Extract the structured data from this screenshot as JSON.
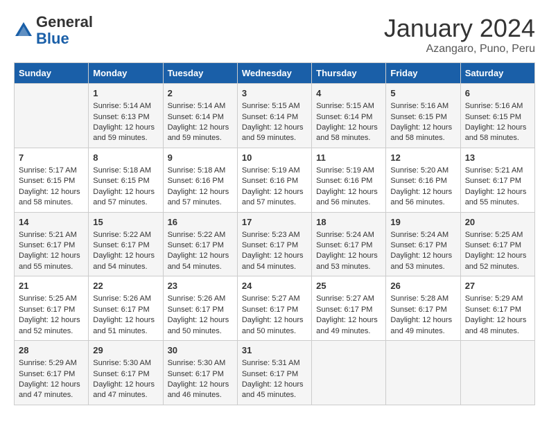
{
  "header": {
    "logo_general": "General",
    "logo_blue": "Blue",
    "month": "January 2024",
    "location": "Azangaro, Puno, Peru"
  },
  "days_of_week": [
    "Sunday",
    "Monday",
    "Tuesday",
    "Wednesday",
    "Thursday",
    "Friday",
    "Saturday"
  ],
  "weeks": [
    [
      {
        "day": "",
        "info": ""
      },
      {
        "day": "1",
        "info": "Sunrise: 5:14 AM\nSunset: 6:13 PM\nDaylight: 12 hours\nand 59 minutes."
      },
      {
        "day": "2",
        "info": "Sunrise: 5:14 AM\nSunset: 6:14 PM\nDaylight: 12 hours\nand 59 minutes."
      },
      {
        "day": "3",
        "info": "Sunrise: 5:15 AM\nSunset: 6:14 PM\nDaylight: 12 hours\nand 59 minutes."
      },
      {
        "day": "4",
        "info": "Sunrise: 5:15 AM\nSunset: 6:14 PM\nDaylight: 12 hours\nand 58 minutes."
      },
      {
        "day": "5",
        "info": "Sunrise: 5:16 AM\nSunset: 6:15 PM\nDaylight: 12 hours\nand 58 minutes."
      },
      {
        "day": "6",
        "info": "Sunrise: 5:16 AM\nSunset: 6:15 PM\nDaylight: 12 hours\nand 58 minutes."
      }
    ],
    [
      {
        "day": "7",
        "info": "Sunrise: 5:17 AM\nSunset: 6:15 PM\nDaylight: 12 hours\nand 58 minutes."
      },
      {
        "day": "8",
        "info": "Sunrise: 5:18 AM\nSunset: 6:15 PM\nDaylight: 12 hours\nand 57 minutes."
      },
      {
        "day": "9",
        "info": "Sunrise: 5:18 AM\nSunset: 6:16 PM\nDaylight: 12 hours\nand 57 minutes."
      },
      {
        "day": "10",
        "info": "Sunrise: 5:19 AM\nSunset: 6:16 PM\nDaylight: 12 hours\nand 57 minutes."
      },
      {
        "day": "11",
        "info": "Sunrise: 5:19 AM\nSunset: 6:16 PM\nDaylight: 12 hours\nand 56 minutes."
      },
      {
        "day": "12",
        "info": "Sunrise: 5:20 AM\nSunset: 6:16 PM\nDaylight: 12 hours\nand 56 minutes."
      },
      {
        "day": "13",
        "info": "Sunrise: 5:21 AM\nSunset: 6:17 PM\nDaylight: 12 hours\nand 55 minutes."
      }
    ],
    [
      {
        "day": "14",
        "info": "Sunrise: 5:21 AM\nSunset: 6:17 PM\nDaylight: 12 hours\nand 55 minutes."
      },
      {
        "day": "15",
        "info": "Sunrise: 5:22 AM\nSunset: 6:17 PM\nDaylight: 12 hours\nand 54 minutes."
      },
      {
        "day": "16",
        "info": "Sunrise: 5:22 AM\nSunset: 6:17 PM\nDaylight: 12 hours\nand 54 minutes."
      },
      {
        "day": "17",
        "info": "Sunrise: 5:23 AM\nSunset: 6:17 PM\nDaylight: 12 hours\nand 54 minutes."
      },
      {
        "day": "18",
        "info": "Sunrise: 5:24 AM\nSunset: 6:17 PM\nDaylight: 12 hours\nand 53 minutes."
      },
      {
        "day": "19",
        "info": "Sunrise: 5:24 AM\nSunset: 6:17 PM\nDaylight: 12 hours\nand 53 minutes."
      },
      {
        "day": "20",
        "info": "Sunrise: 5:25 AM\nSunset: 6:17 PM\nDaylight: 12 hours\nand 52 minutes."
      }
    ],
    [
      {
        "day": "21",
        "info": "Sunrise: 5:25 AM\nSunset: 6:17 PM\nDaylight: 12 hours\nand 52 minutes."
      },
      {
        "day": "22",
        "info": "Sunrise: 5:26 AM\nSunset: 6:17 PM\nDaylight: 12 hours\nand 51 minutes."
      },
      {
        "day": "23",
        "info": "Sunrise: 5:26 AM\nSunset: 6:17 PM\nDaylight: 12 hours\nand 50 minutes."
      },
      {
        "day": "24",
        "info": "Sunrise: 5:27 AM\nSunset: 6:17 PM\nDaylight: 12 hours\nand 50 minutes."
      },
      {
        "day": "25",
        "info": "Sunrise: 5:27 AM\nSunset: 6:17 PM\nDaylight: 12 hours\nand 49 minutes."
      },
      {
        "day": "26",
        "info": "Sunrise: 5:28 AM\nSunset: 6:17 PM\nDaylight: 12 hours\nand 49 minutes."
      },
      {
        "day": "27",
        "info": "Sunrise: 5:29 AM\nSunset: 6:17 PM\nDaylight: 12 hours\nand 48 minutes."
      }
    ],
    [
      {
        "day": "28",
        "info": "Sunrise: 5:29 AM\nSunset: 6:17 PM\nDaylight: 12 hours\nand 47 minutes."
      },
      {
        "day": "29",
        "info": "Sunrise: 5:30 AM\nSunset: 6:17 PM\nDaylight: 12 hours\nand 47 minutes."
      },
      {
        "day": "30",
        "info": "Sunrise: 5:30 AM\nSunset: 6:17 PM\nDaylight: 12 hours\nand 46 minutes."
      },
      {
        "day": "31",
        "info": "Sunrise: 5:31 AM\nSunset: 6:17 PM\nDaylight: 12 hours\nand 45 minutes."
      },
      {
        "day": "",
        "info": ""
      },
      {
        "day": "",
        "info": ""
      },
      {
        "day": "",
        "info": ""
      }
    ]
  ]
}
